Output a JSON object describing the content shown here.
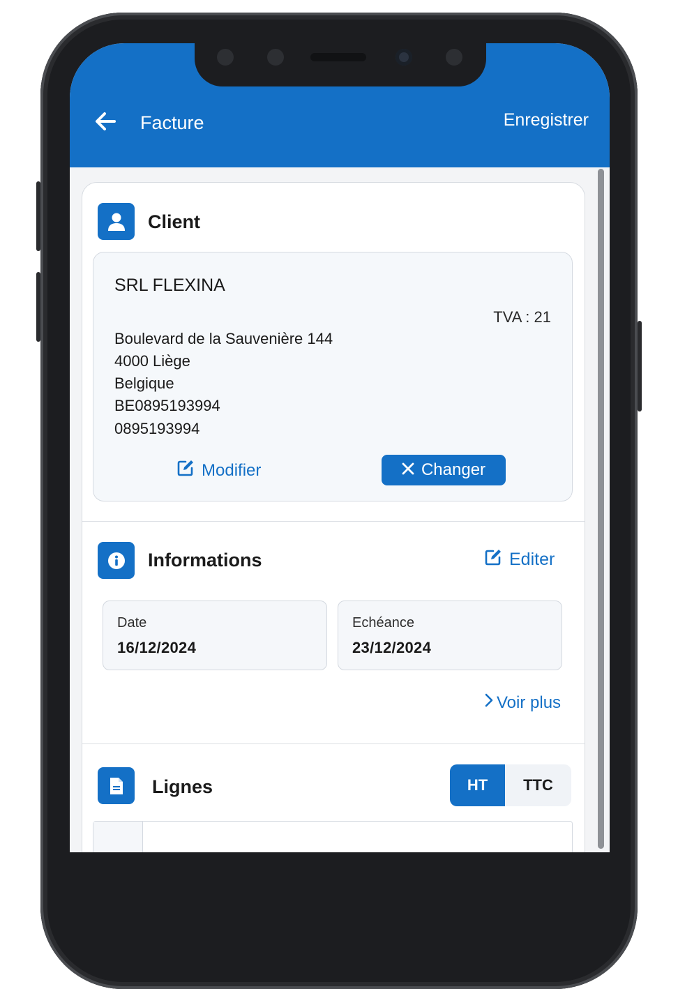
{
  "appbar": {
    "title": "Facture",
    "action": "Enregistrer"
  },
  "client": {
    "section_title": "Client",
    "name": "SRL FLEXINA",
    "tva": "TVA : 21",
    "address_lines": [
      "Boulevard de la Sauvenière 144",
      "4000 Liège",
      "Belgique",
      "BE0895193994",
      "0895193994"
    ],
    "modify_label": "Modifier",
    "change_label": "Changer"
  },
  "informations": {
    "section_title": "Informations",
    "edit_label": "Editer",
    "date_label": "Date",
    "date_value": "16/12/2024",
    "due_label": "Echéance",
    "due_value": "23/12/2024",
    "more_label": "Voir plus"
  },
  "lignes": {
    "section_title": "Lignes",
    "toggle": {
      "ht": "HT",
      "ttc": "TTC",
      "selected": "HT"
    }
  },
  "colors": {
    "primary": "#1470c6",
    "surface": "#ffffff",
    "background": "#f3f4f6"
  }
}
